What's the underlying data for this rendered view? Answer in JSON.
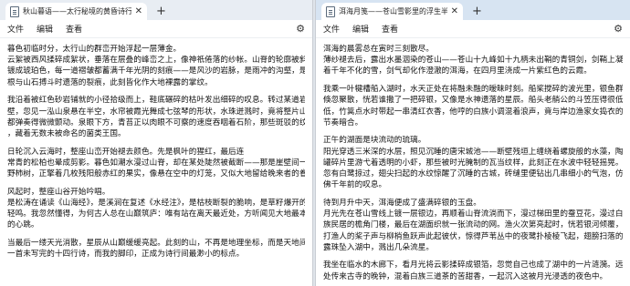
{
  "left_window": {
    "tab_title": "秋山暮语——太行秘境的黄昏诗行",
    "menu": [
      "文件",
      "编辑",
      "查看"
    ],
    "paragraphs": [
      [
        "暮色初临时分，太行山的群峦开始浮起一层薄金。",
        "云絮被西风揉碎成絮状，垂落在层叠的峰峦之上，像神祇倦落的纱帐。山脊的轮廓被斜阳",
        "镀成琥珀色，每一道褶皱都蓄满千年光阴的刻痕——是风沙的岩脉，是雨冲的沟壑，是树",
        "根与山石搏斗时遗落的裂痕，此刻皆化作大地裸露的掌纹。"
      ],
      [
        "我沿着被红色砂岩铺就的小径拾级而上，鞋底碾碎的枯叶发出细碎的叹息。转过某道岩",
        "壁，忽见一泓山泉悬在半空，水帘被霞光舞成七弦琴的形状，水珠迸溅时，竟将整片山色",
        "都弹奏得微微颤动。泉眼下方，青苔正以肉眼不可察的速度吞咽着石阶，那些斑驳的纹路",
        "，藏着无数未被命名的菌类王国。"
      ],
      [
        "日轮沉入云海时，整座山峦开始褪去颜色。先是枫叶的猩红，最后连",
        "常青的松柏也晕成剪影。暮色如潮水漫过山脊，却在某处陡然被截断——那是崖壁间一株",
        "野柿树，正擎着几枚残阳般赤红的果实，像悬在空中的灯笼，又似大地留给晚来者的眷顾。"
      ],
      [
        "风起时，整座山谷开始吟唱。",
        "是松涛在诵读《山海经》，是溪涧在复述《水经注》，是枯枝断裂的脆响，是草籽爆开的",
        "轻鸣。我忽然懂得，为何古人总在山巅筑庐：唯有站在离天最近处，方听闻见大地最本真",
        "的心跳。"
      ],
      [
        "当最后一缕天光消散，星辰从山巅缓缓亮起。此刻的山，不再是地理坐标，而是天地间",
        "一首未写完的十四行诗，而我的脚印，正成为诗行间最渺小的标点。"
      ]
    ]
  },
  "right_window": {
    "tab_title": "洱海月笺——苍山雪影里的浮生半日",
    "menu": [
      "文件",
      "编辑",
      "查看"
    ],
    "paragraphs": [
      [
        "洱海的晨雾总在寅时三刻散尽。",
        "薄纱褪去后，露出水墨洇染的苍山——苍山十九峰如十九柄未出鞘的青铜剑，剑鞘上凝",
        "着千年不化的雪，剑气却化作澄澈的洱海，在四月里浇成一片紫红色的云霞。"
      ],
      [
        "我乘一叶犍槽船入湖时，水天正处在将融未融的暧昧时刻。船桨搅碎的波光里，银鱼群",
        "倏忽聚散，恍若谁撒了一把碎银，又像是水神遗落的星辰。船头老艄公的斗笠压得很低",
        "低，竹篙点水时带起一串清红衣香，他哼的白族小调混着浪声，竟与岸边渔家女捣衣的",
        "节奏暗合。"
      ],
      [
        "正午的湖面是块流动的琉璃。",
        "阳光穿透三米深的水层，照见沉睡的唐宋城池——断壁残垣上缠绕着螺旋般的水藻，陶",
        "罐碎片里游弋着透明的小虾，那些被时光腌制的瓦当纹样，此刻正在水波中轻轻摇晃。",
        "忽有白鹭掠过，翅尖扫起的水纹惊醒了沉睡的古城，砖缝里便钻出几串细小的气泡，仿",
        "佛千年前的叹息。"
      ],
      [
        "待到月升中天，洱海便成了盛满碎银的玉盘。",
        "月光先在苍山雪线上镀一层银边，再顺着山脊流淌而下，漫过梯田里的蚕豆花，漫过白",
        "族民居的檐角门楼，最后在湖面织就一张流动的网。渔火次第亮起时，恍若银河倾覆，",
        "打渔人的桨子声与柳梢鱼跃声此起彼伏，惊得芦苇丛中的夜鹭扑棱棱飞起，翅膀扫落的",
        "露珠坠入湖中，溅出几朵流星。"
      ],
      [
        "我坐在临水的木廊下，看月光将云影揉碎成银箔，忽觉自己也成了湖中的一片涟漪。远",
        "处传来古寺的晚钟，混着白族三道茶的苦甜香，一起沉入这被月光浸透的夜色中。"
      ]
    ]
  }
}
